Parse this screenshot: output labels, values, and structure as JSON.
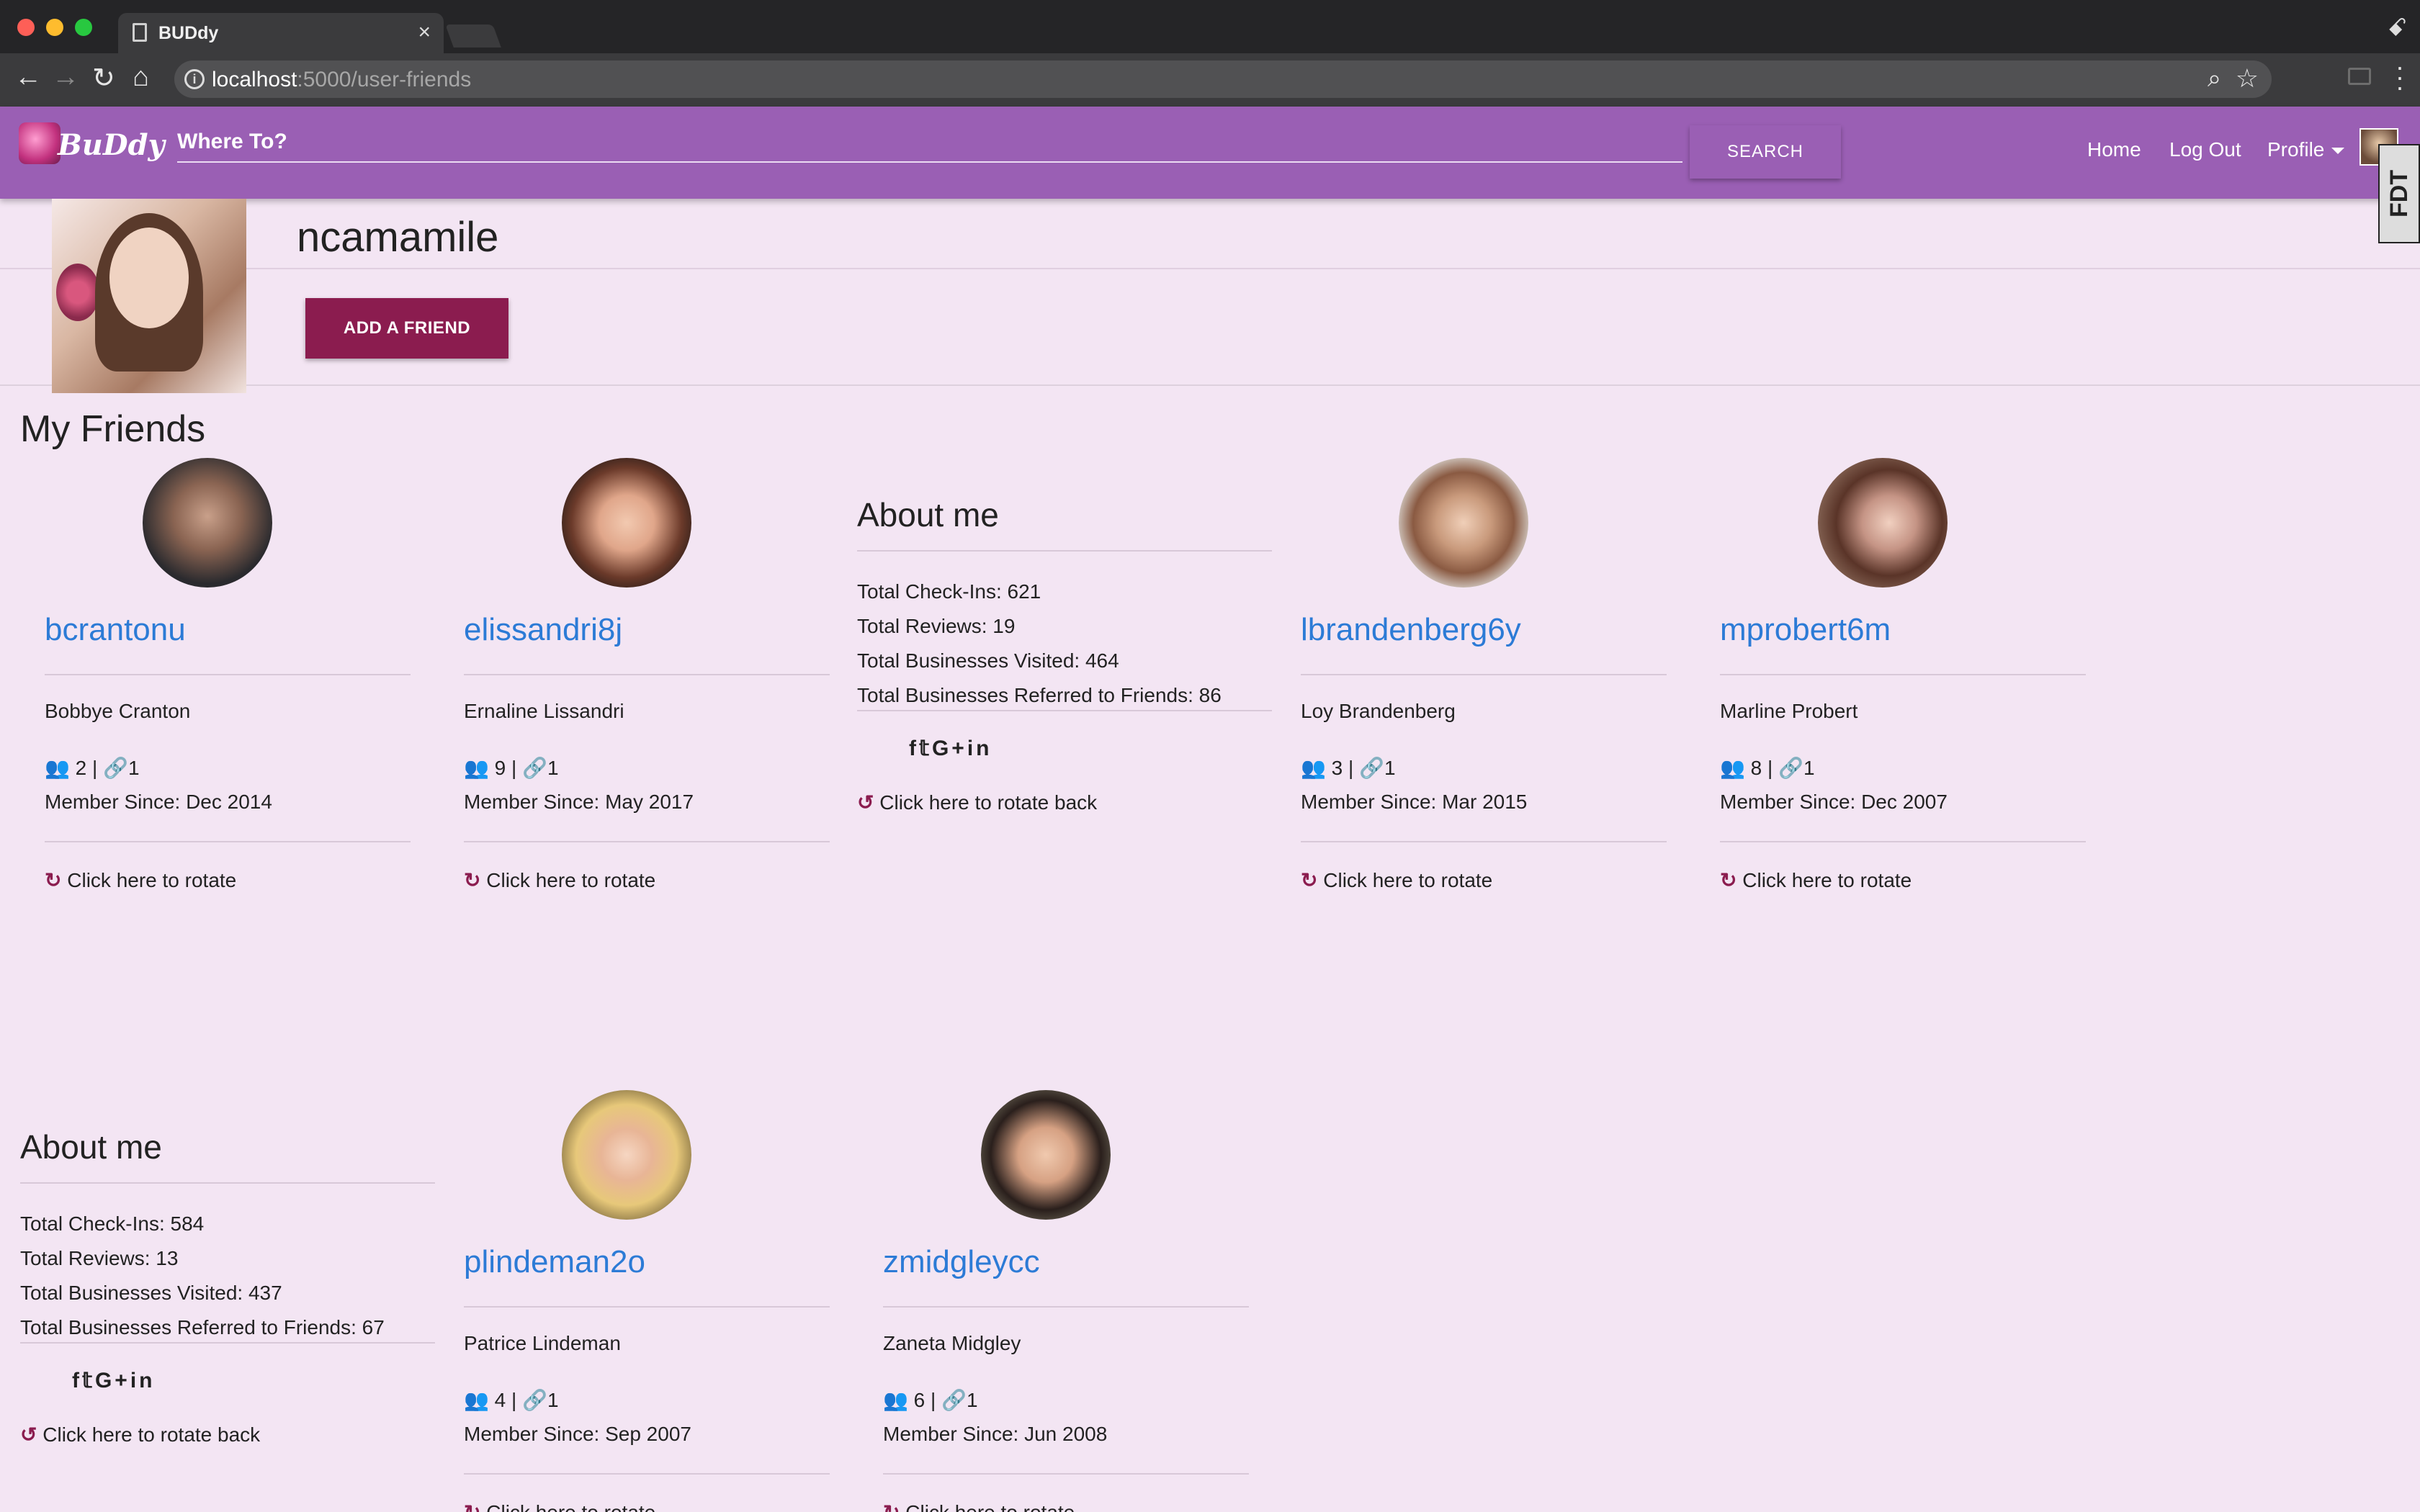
{
  "browser": {
    "tab_title": "BUDdy",
    "tab_close": "×",
    "url_host": "localhost",
    "url_path": ":5000/user-friends",
    "info_icon": "info-icon",
    "incognito_icon": "incognito-icon"
  },
  "navbar": {
    "logo_text": "BuDdy",
    "search_placeholder": "Where To?",
    "search_button": "SEARCH",
    "links": {
      "home": "Home",
      "logout": "Log Out",
      "profile": "Profile"
    },
    "badge": "FDT",
    "color": "#9a5fb4"
  },
  "profile": {
    "username": "ncamamile",
    "add_friend_button": "ADD A FRIEND",
    "button_color": "#8b1c4f"
  },
  "section_title": "My Friends",
  "friends": [
    {
      "username": "bcrantonu",
      "full_name": "Bobbye Cranton",
      "friends_count": "2",
      "links_count": "1",
      "member_since": "Member Since: Dec 2014",
      "rotate_label": "Click here to rotate"
    },
    {
      "username": "elissandri8j",
      "full_name": "Ernaline Lissandri",
      "friends_count": "9",
      "links_count": "1",
      "member_since": "Member Since: May 2017",
      "rotate_label": "Click here to rotate"
    },
    {
      "username": "lbrandenberg6y",
      "full_name": "Loy Brandenberg",
      "friends_count": "3",
      "links_count": "1",
      "member_since": "Member Since: Mar 2015",
      "rotate_label": "Click here to rotate"
    },
    {
      "username": "mprobert6m",
      "full_name": "Marline Probert",
      "friends_count": "8",
      "links_count": "1",
      "member_since": "Member Since: Dec 2007",
      "rotate_label": "Click here to rotate"
    },
    {
      "username": "plindeman2o",
      "full_name": "Patrice Lindeman",
      "friends_count": "4",
      "links_count": "1",
      "member_since": "Member Since: Sep 2007",
      "rotate_label": "Click here to rotate"
    },
    {
      "username": "zmidgleycc",
      "full_name": "Zaneta Midgley",
      "friends_count": "6",
      "links_count": "1",
      "member_since": "Member Since: Jun 2008",
      "rotate_label": "Click here to rotate"
    }
  ],
  "about_cards": [
    {
      "title": "About me",
      "checkins": "Total Check-Ins: 621",
      "reviews": "Total Reviews: 19",
      "visited": "Total Businesses Visited: 464",
      "referred": "Total Businesses Referred to Friends: 86",
      "socials": "f",
      "socials_t": "𝕥",
      "socials_g": "G+",
      "socials_in": "in",
      "rotate_back": "Click here to rotate back"
    },
    {
      "title": "About me",
      "checkins": "Total Check-Ins: 584",
      "reviews": "Total Reviews: 13",
      "visited": "Total Businesses Visited: 437",
      "referred": "Total Businesses Referred to Friends: 67",
      "socials": "f",
      "socials_t": "𝕥",
      "socials_g": "G+",
      "socials_in": "in",
      "rotate_back": "Click here to rotate back"
    }
  ],
  "separator": "|",
  "rotate_glyph": "↻",
  "rotate_back_glyph": "↺"
}
